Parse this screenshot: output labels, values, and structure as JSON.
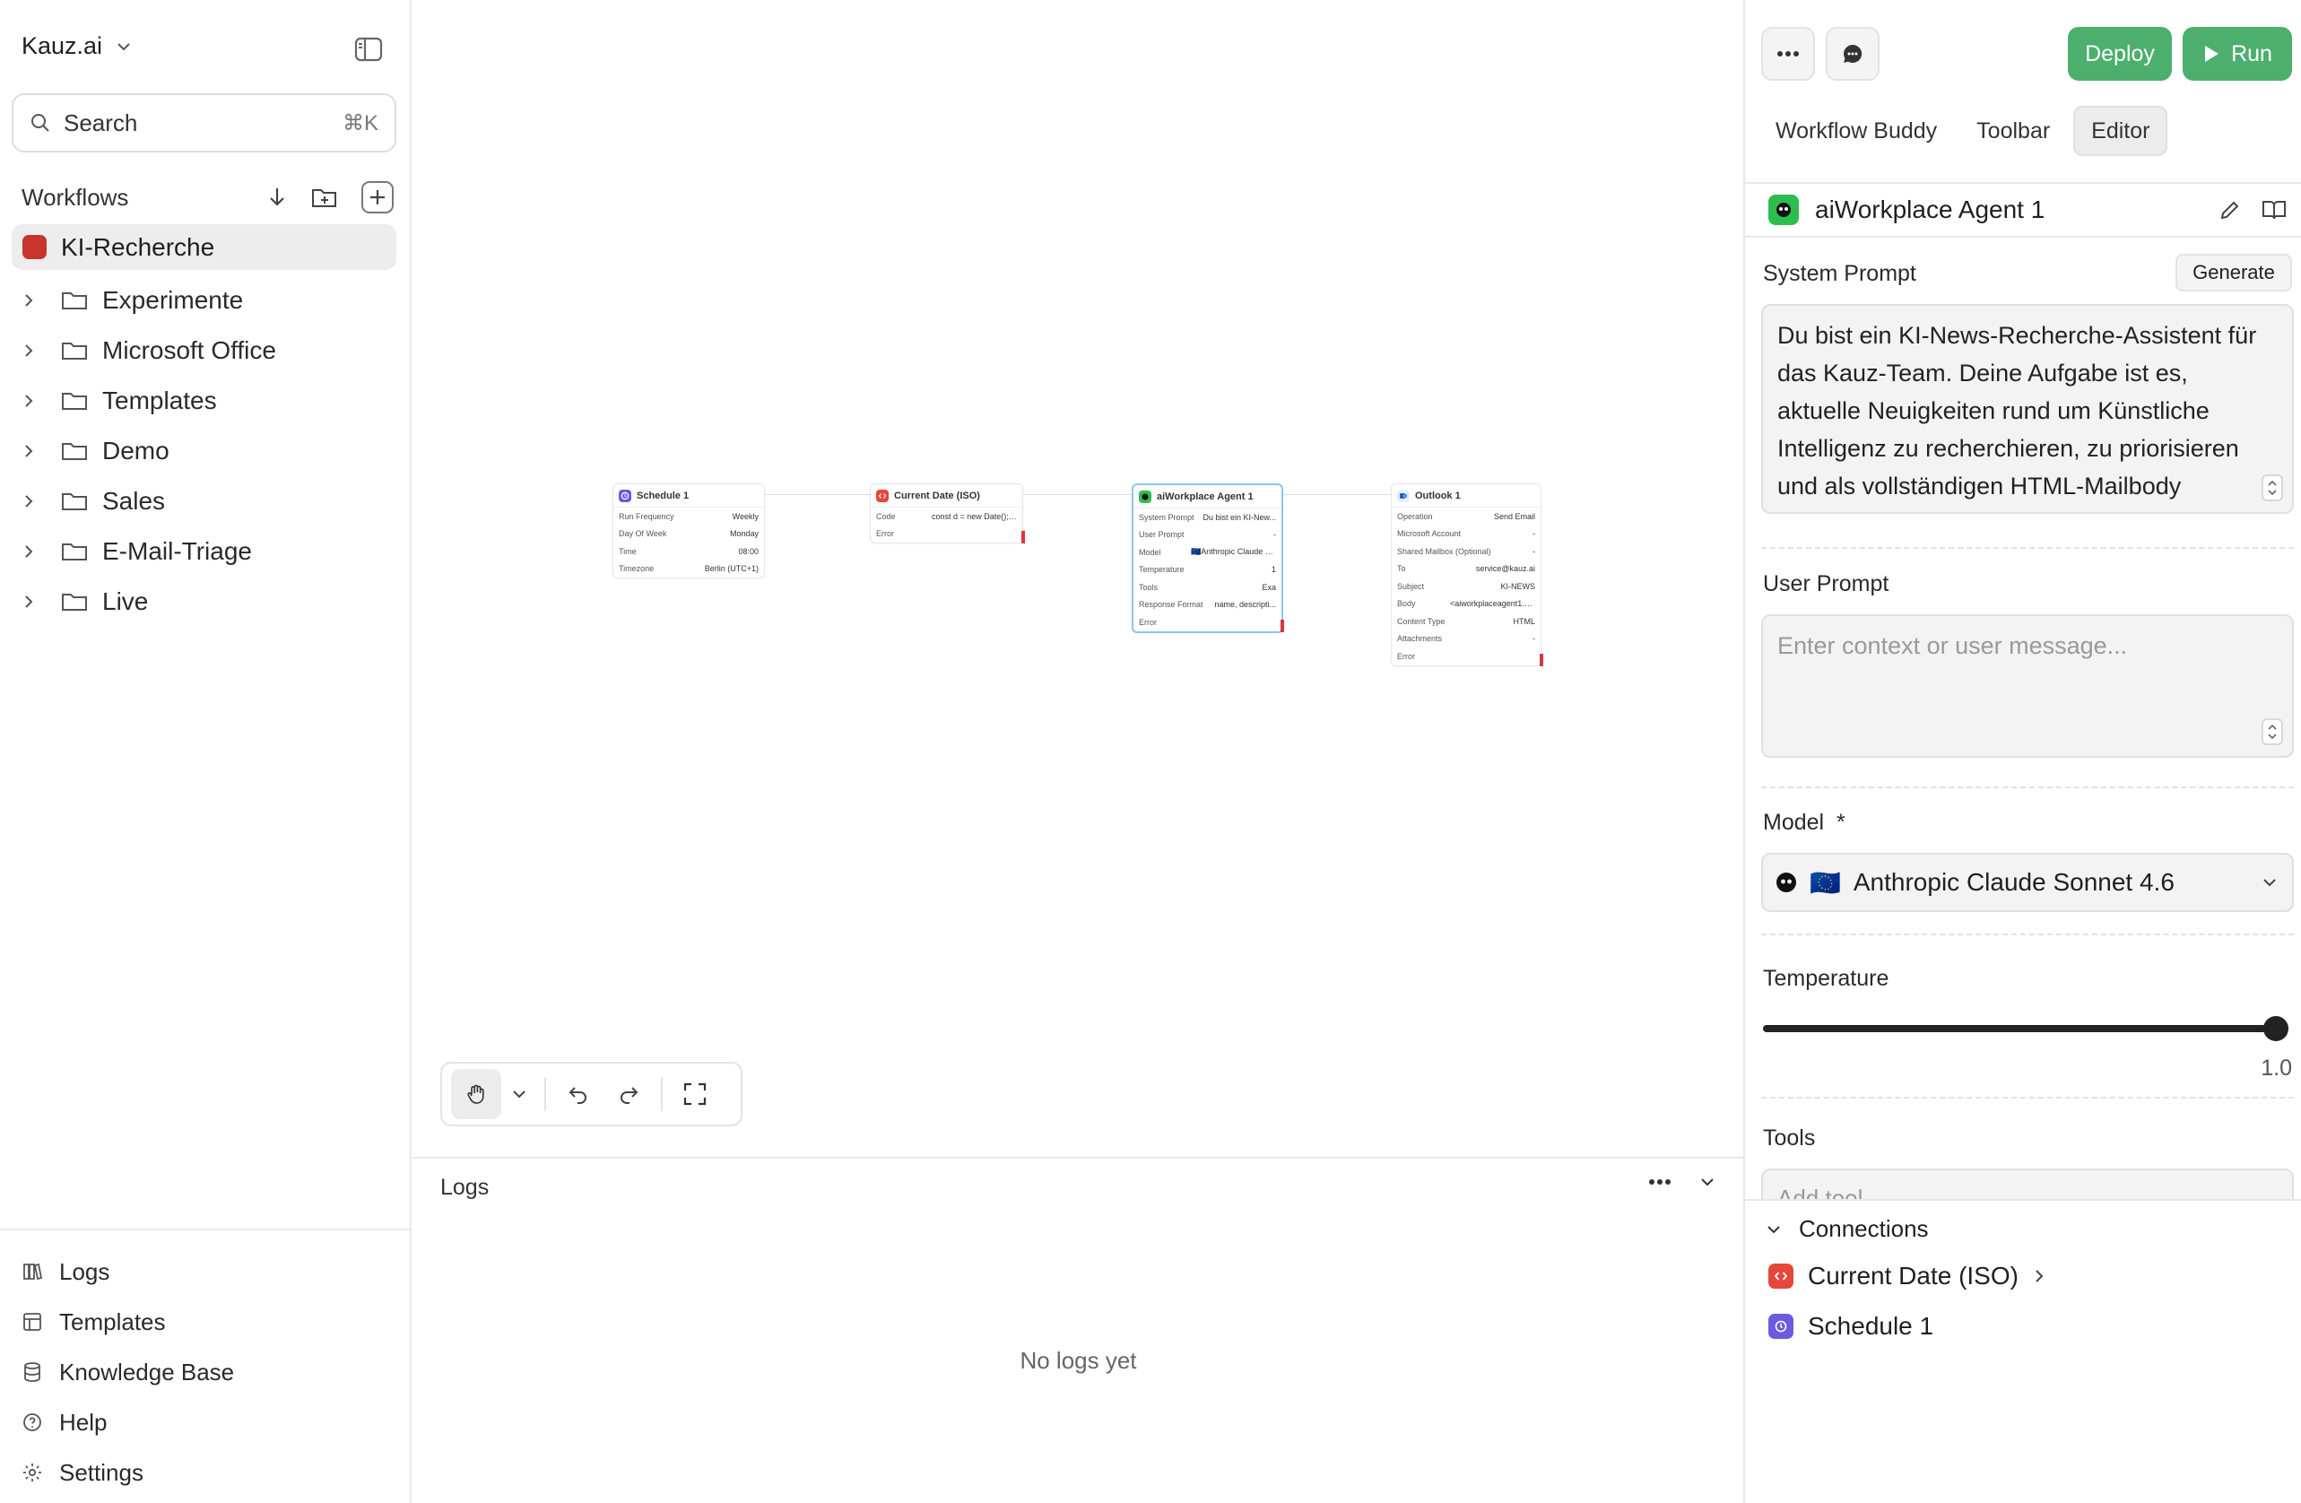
{
  "workspace": {
    "name": "Kauz.ai"
  },
  "search": {
    "placeholder": "Search",
    "shortcut": "⌘K"
  },
  "sidebar": {
    "section_title": "Workflows",
    "active_workflow": "KI-Recherche",
    "active_color": "#c8342e",
    "folders": [
      "Experimente",
      "Microsoft Office",
      "Templates",
      "Demo",
      "Sales",
      "E-Mail-Triage",
      "Live"
    ],
    "bottom_items": [
      {
        "label": "Logs",
        "icon": "book-icon"
      },
      {
        "label": "Templates",
        "icon": "layout-icon"
      },
      {
        "label": "Knowledge Base",
        "icon": "database-icon"
      },
      {
        "label": "Help",
        "icon": "help-circle-icon"
      },
      {
        "label": "Settings",
        "icon": "gear-icon"
      }
    ]
  },
  "nodes": {
    "schedule": {
      "title": "Schedule 1",
      "rows": [
        [
          "Run Frequency",
          "Weekly"
        ],
        [
          "Day Of Week",
          "Monday"
        ],
        [
          "Time",
          "08:00"
        ],
        [
          "Timezone",
          "Berlin (UTC+1)"
        ]
      ]
    },
    "current_date": {
      "title": "Current Date (ISO)",
      "rows": [
        [
          "Code",
          "const d = new Date(); return ..."
        ],
        [
          "Error",
          ""
        ]
      ]
    },
    "agent": {
      "title": "aiWorkplace Agent 1",
      "rows": [
        [
          "System Prompt",
          "Du bist ein KI-New..."
        ],
        [
          "User Prompt",
          "-"
        ],
        [
          "Model",
          "🇪🇺Anthropic Claude Sonne..."
        ],
        [
          "Temperature",
          "1"
        ],
        [
          "Tools",
          "Exa"
        ],
        [
          "Response Format",
          "name, descripti..."
        ],
        [
          "Error",
          ""
        ]
      ]
    },
    "outlook": {
      "title": "Outlook 1",
      "rows": [
        [
          "Operation",
          "Send Email"
        ],
        [
          "Microsoft Account",
          "-"
        ],
        [
          "Shared Mailbox (Optional)",
          "-"
        ],
        [
          "To",
          "service@kauz.ai"
        ],
        [
          "Subject",
          "KI-NEWS"
        ],
        [
          "Body",
          "<aiworkplaceagent1.body>"
        ],
        [
          "Content Type",
          "HTML"
        ],
        [
          "Attachments",
          "-"
        ],
        [
          "Error",
          ""
        ]
      ]
    }
  },
  "logs": {
    "title": "Logs",
    "empty_text": "No logs yet"
  },
  "panel": {
    "deploy_label": "Deploy",
    "run_label": "Run",
    "accent": "#4caf6e",
    "tabs": [
      "Workflow Buddy",
      "Toolbar",
      "Editor"
    ],
    "active_tab": "Editor",
    "block_title": "aiWorkplace Agent 1",
    "system_prompt_label": "System Prompt",
    "generate_label": "Generate",
    "system_prompt_value": "Du bist ein KI-News-Recherche-Assistent für das Kauz-Team. Deine Aufgabe ist es, aktuelle Neuigkeiten rund um Künstliche Intelligenz zu recherchieren, zu priorisieren und als vollständigen HTML-Mailbody",
    "user_prompt_label": "User Prompt",
    "user_prompt_placeholder": "Enter context or user message...",
    "model_label": "Model",
    "model_required": "*",
    "model_flag": "🇪🇺",
    "model_value": "Anthropic Claude Sonnet 4.6",
    "temperature_label": "Temperature",
    "temperature_value": "1.0",
    "temperature_fraction": 1.0,
    "tools_label": "Tools",
    "tools_placeholder": "Add tool",
    "connections_title": "Connections",
    "connections": [
      {
        "label": "Current Date (ISO)",
        "color": "#e5483a"
      },
      {
        "label": "Schedule 1",
        "color": "#6a5be0"
      }
    ]
  }
}
